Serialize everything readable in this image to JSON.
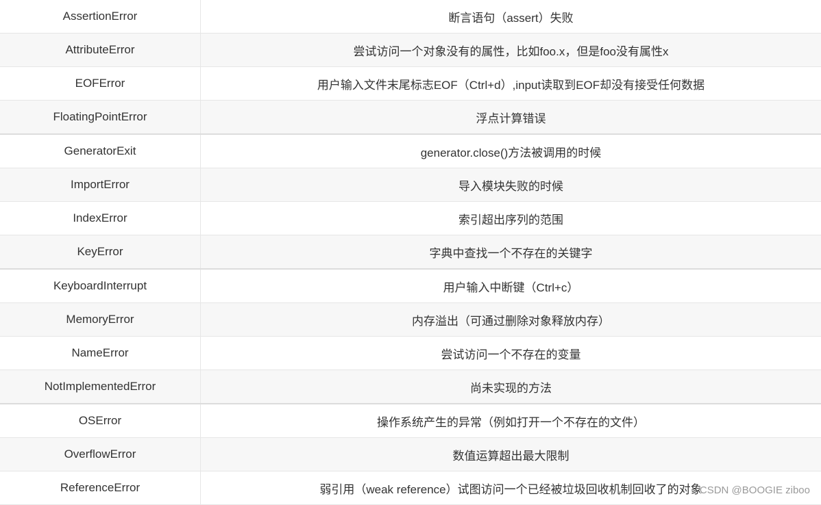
{
  "rows": [
    {
      "name": "AssertionError",
      "description": "断言语句（assert）失败"
    },
    {
      "name": "AttributeError",
      "description": "尝试访问一个对象没有的属性，比如foo.x，但是foo没有属性x"
    },
    {
      "name": "EOFError",
      "description": "用户输入文件末尾标志EOF（Ctrl+d）,input读取到EOF却没有接受任何数据"
    },
    {
      "name": "FloatingPointError",
      "description": "浮点计算错误"
    },
    {
      "name": "GeneratorExit",
      "description": "generator.close()方法被调用的时候"
    },
    {
      "name": "ImportError",
      "description": "导入模块失败的时候"
    },
    {
      "name": "IndexError",
      "description": "索引超出序列的范围"
    },
    {
      "name": "KeyError",
      "description": "字典中查找一个不存在的关键字"
    },
    {
      "name": "KeyboardInterrupt",
      "description": "用户输入中断键（Ctrl+c）"
    },
    {
      "name": "MemoryError",
      "description": "内存溢出（可通过删除对象释放内存）"
    },
    {
      "name": "NameError",
      "description": "尝试访问一个不存在的变量"
    },
    {
      "name": "NotImplementedError",
      "description": "尚未实现的方法"
    },
    {
      "name": "OSError",
      "description": "操作系统产生的异常（例如打开一个不存在的文件）"
    },
    {
      "name": "OverflowError",
      "description": "数值运算超出最大限制"
    },
    {
      "name": "ReferenceError",
      "description": "弱引用（weak reference）试图访问一个已经被垃圾回收机制回收了的对象"
    }
  ],
  "watermark": "CSDN @BOOGIE ziboo"
}
